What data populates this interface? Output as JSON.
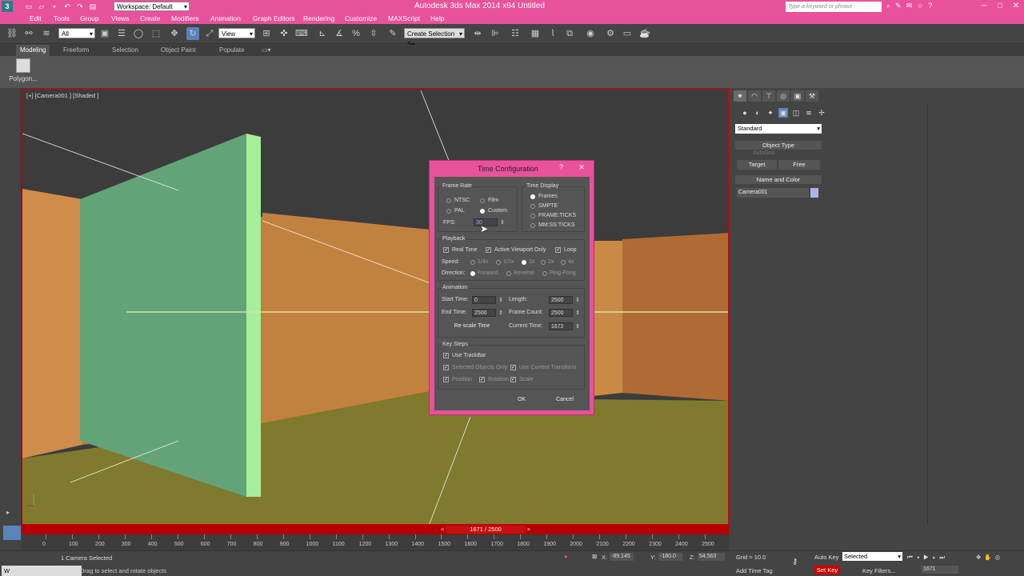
{
  "window": {
    "title": "Autodesk 3ds Max 2014 x64     Untitled",
    "workspace": "Workspace: Default",
    "search_placeholder": "Type a keyword or phrase",
    "app_icon": "3ds-max-logo",
    "accent": "#e8519c"
  },
  "menu": {
    "items": [
      "Edit",
      "Tools",
      "Group",
      "Views",
      "Create",
      "Modifiers",
      "Animation",
      "Graph Editors",
      "Rendering",
      "Customize",
      "MAXScript",
      "Help"
    ]
  },
  "toolbar": {
    "selection_filter": "All",
    "ref_coord": "View",
    "named_selection": "Create Selection Se"
  },
  "ribbon": {
    "tabs": [
      "Modeling",
      "Freeform",
      "Selection",
      "Object Paint",
      "Populate"
    ],
    "active_tab": "Modeling",
    "panel_button": "Polygon..."
  },
  "viewport": {
    "label": "[+] [Camera001 ] [Shaded ]"
  },
  "command_panel": {
    "category": "Standard",
    "object_type_header": "Object Type",
    "autogrid": "AutoGrid",
    "btn_target": "Target",
    "btn_free": "Free",
    "name_color_header": "Name and Color",
    "object_name": "Camera001"
  },
  "timeline": {
    "frame_display": "1671 / 2500",
    "ruler": [
      "0",
      "100",
      "200",
      "300",
      "400",
      "500",
      "600",
      "700",
      "800",
      "900",
      "1000",
      "1100",
      "1200",
      "1300",
      "1400",
      "1500",
      "1600",
      "1700",
      "1800",
      "1900",
      "2000",
      "2100",
      "2200",
      "2300",
      "2400",
      "2500"
    ]
  },
  "status": {
    "selection": "1 Camera Selected",
    "prompt": "Drag to select and rotate objects",
    "x_label": "X:",
    "x": "-89.145",
    "y_label": "Y:",
    "y": "-180.0",
    "z_label": "Z:",
    "z": "54.563",
    "grid": "Grid = 10.0",
    "add_time_tag": "Add Time Tag",
    "auto_key": "Auto Key",
    "set_key": "Set Key",
    "key_mode": "Selected",
    "key_filters": "Key Filters...",
    "current_frame": "1671",
    "taskbar_start": "W"
  },
  "dialog": {
    "title": "Time Configuration",
    "help": "?",
    "close": "✕",
    "frame_rate": {
      "label": "Frame Rate",
      "options": [
        "NTSC",
        "Film",
        "PAL",
        "Custom"
      ],
      "selected": "Custom",
      "fps_label": "FPS:",
      "fps_value": "30"
    },
    "time_display": {
      "label": "Time Display",
      "options": [
        "Frames",
        "SMPTE",
        "FRAME:TICKS",
        "MM:SS:TICKS"
      ],
      "selected": "Frames"
    },
    "playback": {
      "label": "Playback",
      "real_time": "Real Time",
      "active_viewport_only": "Active Viewport Only",
      "loop": "Loop",
      "speed_label": "Speed:",
      "speeds": [
        "1/4x",
        "1/2x",
        "1x",
        "2x",
        "4x"
      ],
      "speed_selected": "1x",
      "direction_label": "Direction:",
      "directions": [
        "Forward",
        "Reverse",
        "Ping-Pong"
      ],
      "direction_selected": "Forward"
    },
    "animation": {
      "label": "Animation",
      "start_time_label": "Start Time:",
      "start_time": "0",
      "length_label": "Length:",
      "length": "2500",
      "end_time_label": "End Time:",
      "end_time": "2500",
      "frame_count_label": "Frame Count:",
      "frame_count": "2500",
      "rescale": "Re-scale Time",
      "current_time_label": "Current Time:",
      "current_time": "1672"
    },
    "key_steps": {
      "label": "Key Steps",
      "use_trackbar": "Use TrackBar",
      "selected_only": "Selected Objects Only",
      "use_current_transform": "Use Current Transform",
      "position": "Position",
      "rotation": "Rotation",
      "scale": "Scale"
    },
    "ok": "OK",
    "cancel": "Cancel"
  }
}
